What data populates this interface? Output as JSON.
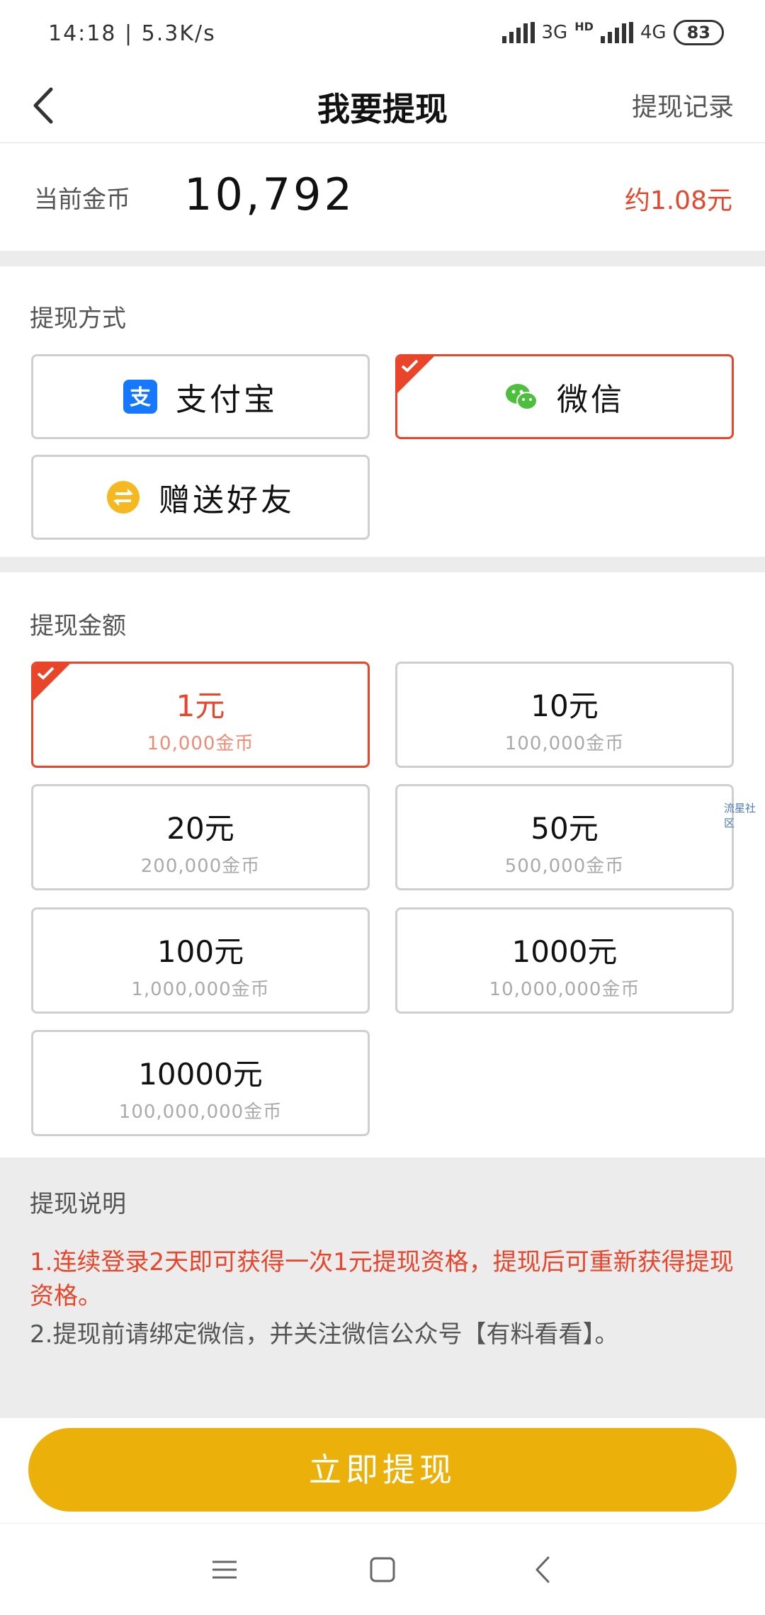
{
  "status": {
    "time": "14:18",
    "speed": "5.3K/s",
    "net1": "3G",
    "hd": "HD",
    "net2": "4G",
    "battery": "83"
  },
  "header": {
    "title": "我要提现",
    "records_label": "提现记录"
  },
  "coins": {
    "label": "当前金币",
    "value": "10,792",
    "approx": "约1.08元"
  },
  "method": {
    "title": "提现方式",
    "options": [
      {
        "label": "支付宝",
        "selected": false
      },
      {
        "label": "微信",
        "selected": true
      },
      {
        "label": "赠送好友",
        "selected": false
      }
    ]
  },
  "amount": {
    "title": "提现金额",
    "options": [
      {
        "main": "1元",
        "sub": "10,000金币",
        "selected": true
      },
      {
        "main": "10元",
        "sub": "100,000金币",
        "selected": false
      },
      {
        "main": "20元",
        "sub": "200,000金币",
        "selected": false
      },
      {
        "main": "50元",
        "sub": "500,000金币",
        "selected": false
      },
      {
        "main": "100元",
        "sub": "1,000,000金币",
        "selected": false
      },
      {
        "main": "1000元",
        "sub": "10,000,000金币",
        "selected": false
      },
      {
        "main": "10000元",
        "sub": "100,000,000金币",
        "selected": false
      }
    ]
  },
  "notes": {
    "title": "提现说明",
    "items": [
      "1.连续登录2天即可获得一次1元提现资格，提现后可重新获得提现资格。",
      "2.提现前请绑定微信，并关注微信公众号【有料看看】。"
    ]
  },
  "watermark": "流星社区",
  "submit_label": "立即提现",
  "colors": {
    "accent": "#e8452a",
    "button": "#ebb00a",
    "alipay": "#1677ff",
    "wechat": "#4cbf3c",
    "friend": "#f5b820"
  }
}
